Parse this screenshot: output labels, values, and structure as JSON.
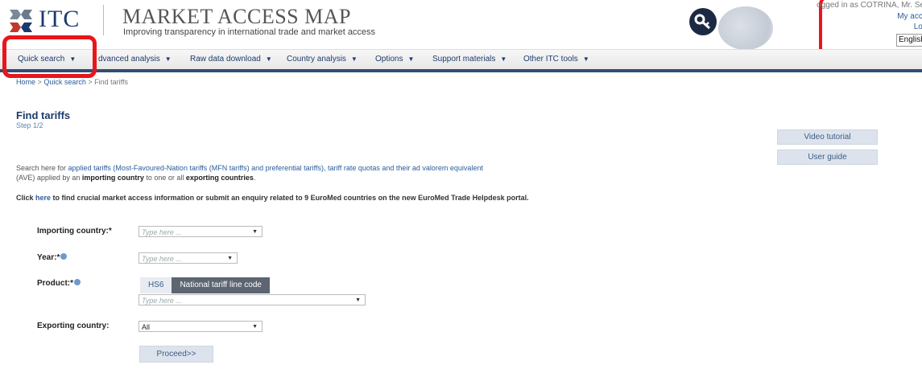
{
  "header": {
    "logo": "ITC",
    "title": "MARKET ACCESS MAP",
    "subtitle": "Improving transparency in international trade and market access"
  },
  "user": {
    "logged_in_text": "ogged in as COTRINA, Mr. Serg",
    "my_account": "My accou",
    "logout": "Logo",
    "language": "English"
  },
  "nav": {
    "items": [
      {
        "label": "Quick search"
      },
      {
        "label": "dvanced analysis"
      },
      {
        "label": "Raw data download"
      },
      {
        "label": "Country analysis"
      },
      {
        "label": "Options"
      },
      {
        "label": "Support materials"
      },
      {
        "label": "Other ITC tools"
      }
    ]
  },
  "breadcrumb": {
    "home": "Home",
    "quick_search": "Quick search",
    "current": "Find tariffs",
    "sep": ">"
  },
  "page": {
    "title": "Find tariffs",
    "step": "Step 1/2"
  },
  "side_buttons": {
    "video": "Video tutorial",
    "guide": "User guide"
  },
  "description": {
    "p1_a": "Search here for ",
    "p1_b": "applied tariffs (Most-Favoured-Nation tariffs (MFN tariffs) and preferential tariffs), tariff rate quotas and their ad valorem equivalent",
    "p2_a": "(AVE) applied by an ",
    "p2_b": "importing country",
    "p2_c": " to one or all ",
    "p2_d": "exporting countries",
    "p2_e": ".",
    "click_a": "Click ",
    "click_here": "here",
    "click_b": " to find crucial market access information or submit an enquiry related to 9 EuroMed countries on the new EuroMed Trade Helpdesk portal."
  },
  "form": {
    "importing_label": "Importing country:*",
    "importing_placeholder": "Type here ...",
    "year_label": "Year:*",
    "year_placeholder": "Type here ...",
    "product_label": "Product:*",
    "product_tab_hs6": "HS6",
    "product_tab_national": "National tariff line code",
    "product_placeholder": "Type here ...",
    "exporting_label": "Exporting country:",
    "exporting_value": "All",
    "proceed": "Proceed>>"
  },
  "colors": {
    "highlight": "#e8161b",
    "brand_navy": "#1d3b6b",
    "nav_rule": "#2f4f75"
  }
}
